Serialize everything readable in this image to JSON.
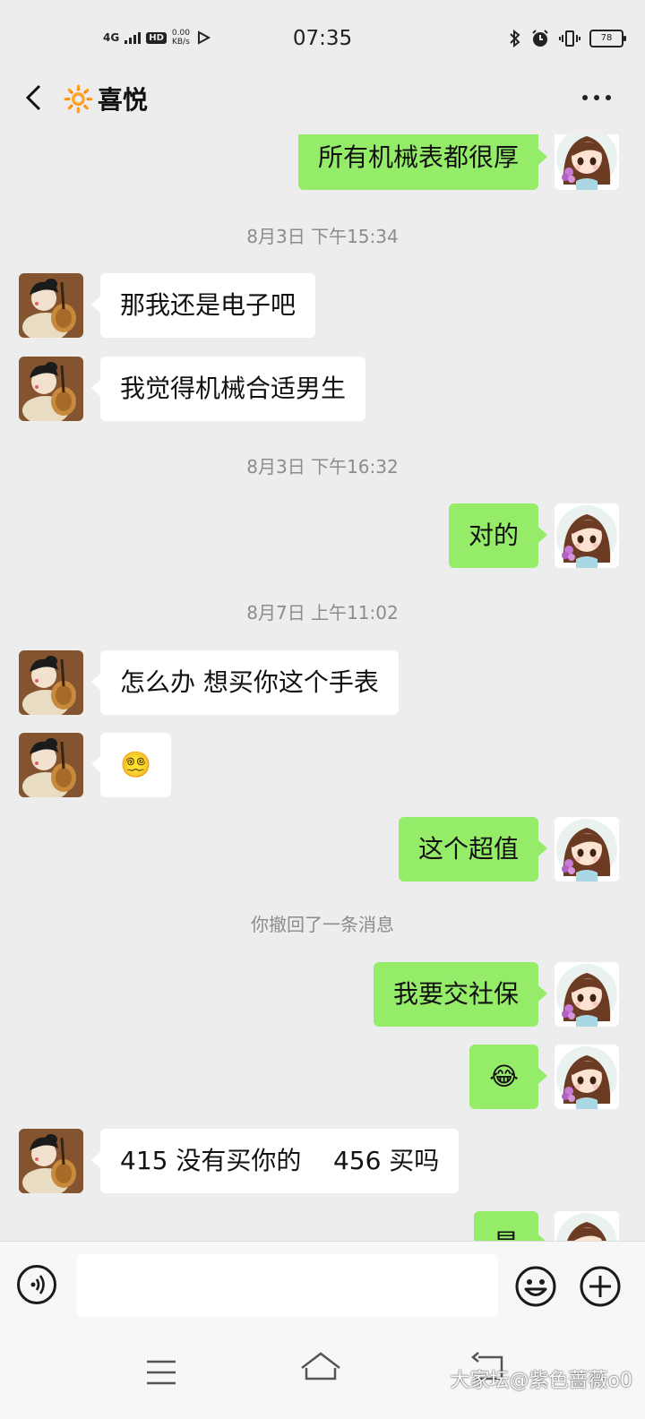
{
  "status_bar": {
    "network": "4G",
    "hd": "HD",
    "speed_value": "0.00",
    "speed_unit": "KB/s",
    "time": "07:35",
    "battery": "78"
  },
  "header": {
    "title_emoji": "🔆",
    "title": "喜悦"
  },
  "messages": [
    {
      "kind": "out",
      "text": "所有机械表都很厚"
    },
    {
      "kind": "time",
      "text": "8月3日 下午15:34"
    },
    {
      "kind": "in",
      "text": "那我还是电子吧"
    },
    {
      "kind": "in",
      "text": "我觉得机械合适男生"
    },
    {
      "kind": "time",
      "text": "8月3日 下午16:32"
    },
    {
      "kind": "out",
      "text": "对的"
    },
    {
      "kind": "time",
      "text": "8月7日 上午11:02"
    },
    {
      "kind": "in",
      "text": "怎么办 想买你这个手表"
    },
    {
      "kind": "in",
      "text": "😵‍💫"
    },
    {
      "kind": "out",
      "text": "这个超值"
    },
    {
      "kind": "system",
      "text": "你撤回了一条消息"
    },
    {
      "kind": "out",
      "text": "我要交社保"
    },
    {
      "kind": "out",
      "text": "😂"
    },
    {
      "kind": "in",
      "text": "415 没有买你的    456 买吗"
    },
    {
      "kind": "out",
      "text": "是"
    }
  ],
  "input_bar": {
    "value": "",
    "placeholder": ""
  },
  "watermark": "大家坛@紫色蔷薇o0",
  "colors": {
    "background": "#ededed",
    "outgoing_bubble": "#95ec69",
    "incoming_bubble": "#ffffff",
    "timestamp": "#8c8c8c"
  },
  "icons": {
    "back": "chevron-left-icon",
    "more": "more-dots-icon",
    "voice": "voice-icon",
    "emoji": "emoji-icon",
    "plus": "plus-icon"
  }
}
